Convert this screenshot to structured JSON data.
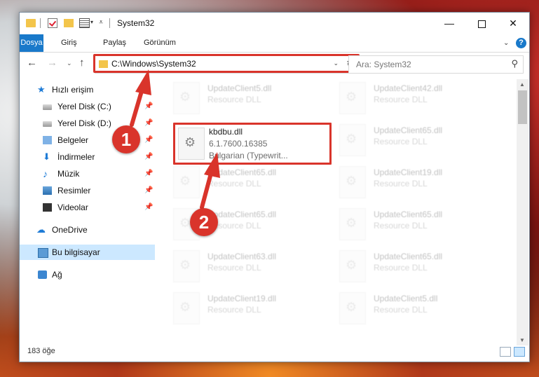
{
  "window": {
    "title": "System32",
    "minimize": "—",
    "close": "✕"
  },
  "ribbon": {
    "tabs": [
      "Dosya",
      "Giriş",
      "Paylaş",
      "Görünüm"
    ],
    "help": "?"
  },
  "address": {
    "path": "C:\\Windows\\System32",
    "search_placeholder": "Ara: System32"
  },
  "sidebar": {
    "quick_access": "Hızlı erişim",
    "items": [
      {
        "label": "Yerel Disk (C:)",
        "icon": "disk-icon",
        "pinned": true
      },
      {
        "label": "Yerel Disk (D:)",
        "icon": "disk-icon",
        "pinned": true
      },
      {
        "label": "Belgeler",
        "icon": "documents-icon",
        "pinned": true
      },
      {
        "label": "İndirmeler",
        "icon": "download-icon",
        "pinned": true
      },
      {
        "label": "Müzik",
        "icon": "music-icon",
        "pinned": true
      },
      {
        "label": "Resimler",
        "icon": "pictures-icon",
        "pinned": true
      },
      {
        "label": "Videolar",
        "icon": "videos-icon",
        "pinned": true
      }
    ],
    "onedrive": "OneDrive",
    "this_pc": "Bu bilgisayar",
    "network": "Ağ"
  },
  "files": {
    "left": [
      {
        "name": "UpdateClient5.dll",
        "type": "Resource DLL"
      },
      {
        "name": "kbdbu.dll",
        "type": "6.1.7600.16385",
        "extra": "Bulgarian (Typewrit..."
      },
      {
        "name": "UpdateClient65.dll",
        "type": "Resource DLL"
      },
      {
        "name": "UpdateClient65.dll",
        "type": "Resource DLL"
      },
      {
        "name": "UpdateClient63.dll",
        "type": "Resource DLL"
      },
      {
        "name": "UpdateClient19.dll",
        "type": "Resource DLL"
      }
    ],
    "right": [
      {
        "name": "UpdateClient42.dll",
        "type": "Resource DLL"
      },
      {
        "name": "UpdateClient65.dll",
        "type": "Resource DLL"
      },
      {
        "name": "UpdateClient19.dll",
        "type": "Resource DLL"
      },
      {
        "name": "UpdateClient65.dll",
        "type": "Resource DLL"
      },
      {
        "name": "UpdateClient65.dll",
        "type": "Resource DLL"
      },
      {
        "name": "UpdateClient5.dll",
        "type": "Resource DLL"
      }
    ]
  },
  "status": {
    "item_count": "183 öğe"
  },
  "annotations": {
    "step1": "1",
    "step2": "2",
    "color": "#d9342b"
  }
}
